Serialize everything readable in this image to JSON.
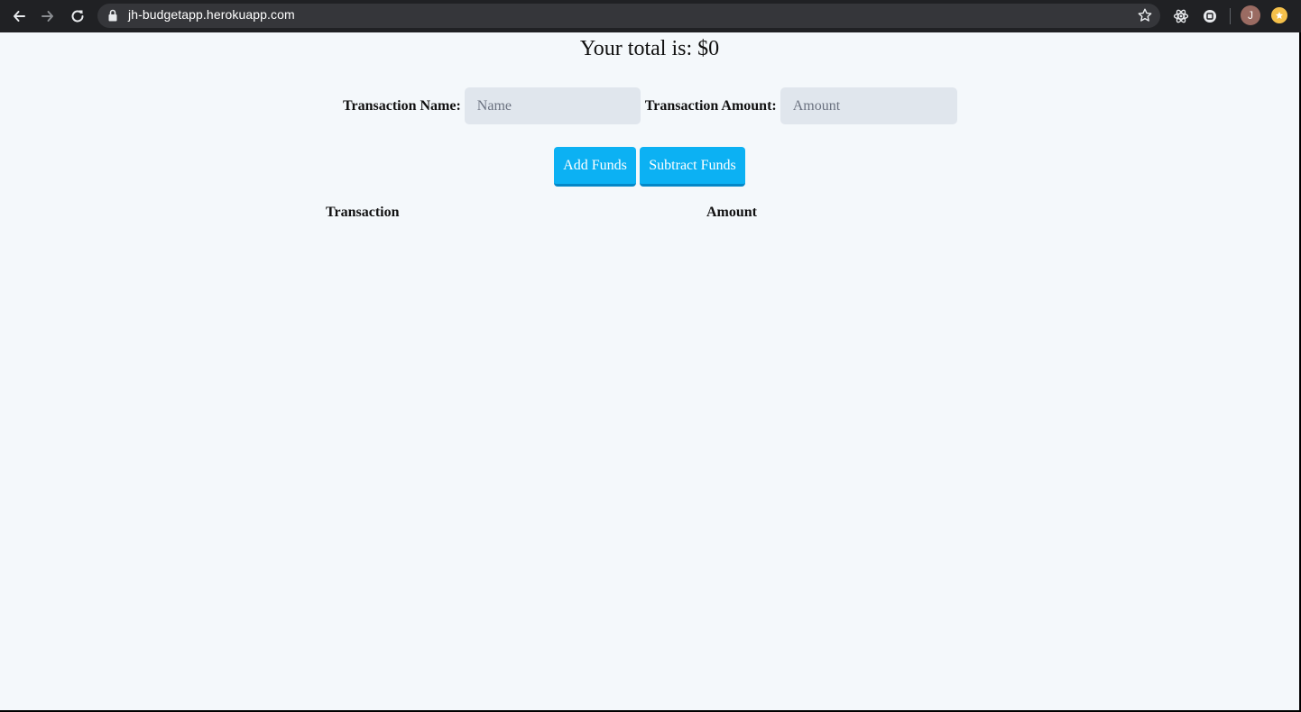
{
  "browser": {
    "url": "jh-budgetapp.herokuapp.com",
    "profile_initial": "J",
    "icons": [
      "back-arrow-icon",
      "forward-arrow-icon",
      "reload-icon",
      "lock-icon",
      "star-icon",
      "react-devtools-icon",
      "extension-icon",
      "profile-avatar",
      "update-icon"
    ]
  },
  "page": {
    "total_text": "Your total is: $0",
    "form": {
      "name_label": "Transaction Name:",
      "name_placeholder": "Name",
      "amount_label": "Transaction Amount:",
      "amount_placeholder": "Amount"
    },
    "buttons": {
      "add_label": "Add Funds",
      "subtract_label": "Subtract Funds"
    },
    "table": {
      "columns": [
        "Transaction",
        "Amount"
      ],
      "rows": []
    }
  },
  "colors": {
    "page_background": "#f4f8fb",
    "button_background": "#0cb1f3",
    "input_background": "#e0e6ed",
    "chrome_background": "#202124"
  }
}
